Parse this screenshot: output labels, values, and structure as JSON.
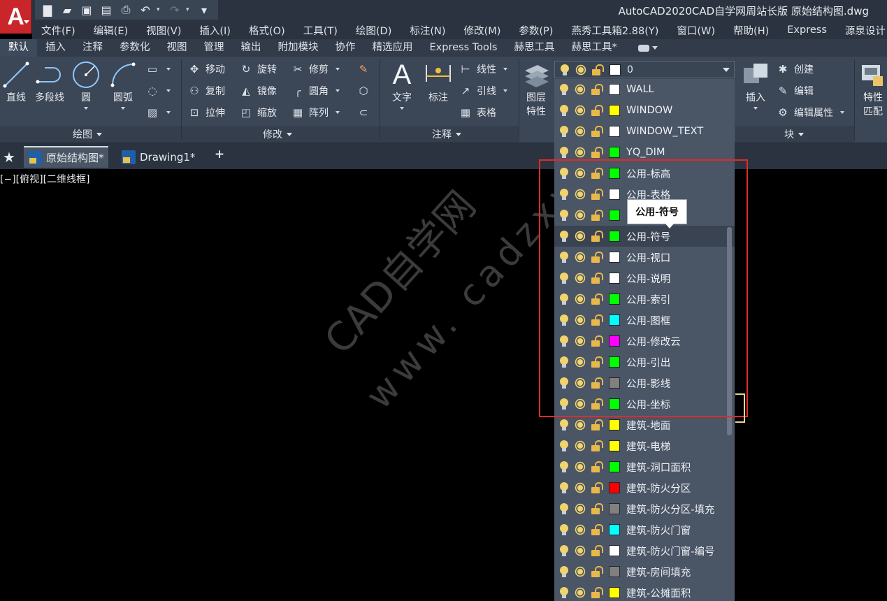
{
  "app": {
    "logo_letter": "A"
  },
  "title_bar": {
    "title": "AutoCAD2020CAD自学网周站长版    原始结构图.dwg"
  },
  "quick_access": [
    "new-icon",
    "open-icon",
    "save-icon",
    "save-as-icon",
    "plot-icon",
    "undo-icon",
    "redo-icon",
    "customize-icon"
  ],
  "menu": [
    "文件(F)",
    "编辑(E)",
    "视图(V)",
    "插入(I)",
    "格式(O)",
    "工具(T)",
    "绘图(D)",
    "标注(N)",
    "修改(M)",
    "参数(P)",
    "燕秀工具箱2.88(Y)",
    "窗口(W)",
    "帮助(H)",
    "Express",
    "源泉设计"
  ],
  "ribbon_tabs": [
    "默认",
    "插入",
    "注释",
    "参数化",
    "视图",
    "管理",
    "输出",
    "附加模块",
    "协作",
    "精选应用",
    "Express Tools",
    "赫思工具",
    "赫思工具*"
  ],
  "ribbon_active_tab": "默认",
  "draw_panel": {
    "title": "绘图",
    "line": "直线",
    "polyline": "多段线",
    "circle": "圆",
    "arc": "圆弧"
  },
  "modify_panel": {
    "title": "修改",
    "move": "移动",
    "rotate": "旋转",
    "trim": "修剪",
    "copy": "复制",
    "mirror": "镜像",
    "fillet": "圆角",
    "stretch": "拉伸",
    "scale": "缩放",
    "array": "阵列"
  },
  "annotation_panel": {
    "title": "注释",
    "text": "文字",
    "dimension": "标注",
    "linear": "线性",
    "leader": "引线",
    "table": "表格"
  },
  "layers_panel": {
    "layer_properties_l1": "图层",
    "layer_properties_l2": "特性",
    "current_layer": "0"
  },
  "block_panel": {
    "title": "块",
    "insert": "插入",
    "create": "创建",
    "edit": "编辑",
    "edit_attributes": "编辑属性"
  },
  "properties_panel": {
    "match_l1": "特性",
    "match_l2": "匹配"
  },
  "file_tabs": [
    {
      "name": "原始结构图*",
      "active": true
    },
    {
      "name": "Drawing1*",
      "active": false
    }
  ],
  "viewport_label": "[−][俯视][二维线框]",
  "watermark": {
    "line1": "CAD自学网",
    "line2": "www. cadzxw. com"
  },
  "layers": [
    {
      "name": "WALL",
      "color": "#ffffff"
    },
    {
      "name": "WINDOW",
      "color": "#ffff00"
    },
    {
      "name": "WINDOW_TEXT",
      "color": "#ffffff"
    },
    {
      "name": "YQ_DIM",
      "color": "#00ff00"
    },
    {
      "name": "公用-标高",
      "color": "#00ff00"
    },
    {
      "name": "公用-表格",
      "color": "#ffffff"
    },
    {
      "name": "公用-符号",
      "color": "#00ff00"
    },
    {
      "name": "公用-符号",
      "color": "#00ff00",
      "hover": true
    },
    {
      "name": "公用-视口",
      "color": "#ffffff"
    },
    {
      "name": "公用-说明",
      "color": "#ffffff"
    },
    {
      "name": "公用-索引",
      "color": "#00ff00"
    },
    {
      "name": "公用-图框",
      "color": "#00ffff"
    },
    {
      "name": "公用-修改云",
      "color": "#ff00ff"
    },
    {
      "name": "公用-引出",
      "color": "#00ff00"
    },
    {
      "name": "公用-影线",
      "color": "#808080"
    },
    {
      "name": "公用-坐标",
      "color": "#00ff00"
    },
    {
      "name": "建筑-地面",
      "color": "#ffff00"
    },
    {
      "name": "建筑-电梯",
      "color": "#ffff00"
    },
    {
      "name": "建筑-洞口面积",
      "color": "#00ff00"
    },
    {
      "name": "建筑-防火分区",
      "color": "#ff0000"
    },
    {
      "name": "建筑-防火分区-填充",
      "color": "#808080"
    },
    {
      "name": "建筑-防火门窗",
      "color": "#00ffff"
    },
    {
      "name": "建筑-防火门窗-编号",
      "color": "#ffffff"
    },
    {
      "name": "建筑-房间填充",
      "color": "#808080"
    },
    {
      "name": "建筑-公摊面积",
      "color": "#ffff00"
    }
  ],
  "tooltip": "公用-符号"
}
